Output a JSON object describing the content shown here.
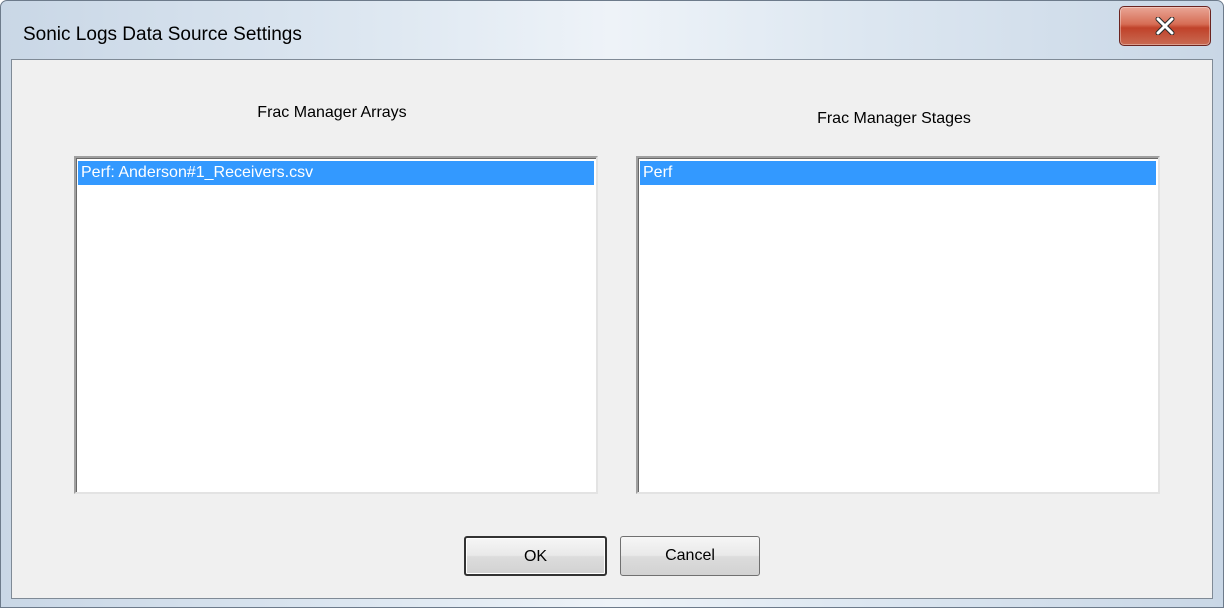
{
  "window": {
    "title": "Sonic Logs Data Source Settings"
  },
  "arrays": {
    "label": "Frac Manager Arrays",
    "items": [
      "Perf: Anderson#1_Receivers.csv"
    ]
  },
  "stages": {
    "label": "Frac Manager Stages",
    "items": [
      "Perf"
    ]
  },
  "buttons": {
    "ok_label": "OK",
    "cancel_label": "Cancel"
  },
  "icons": {
    "close": "close-icon"
  },
  "colors": {
    "selection": "#3399ff",
    "close_button": "#c7432b"
  }
}
